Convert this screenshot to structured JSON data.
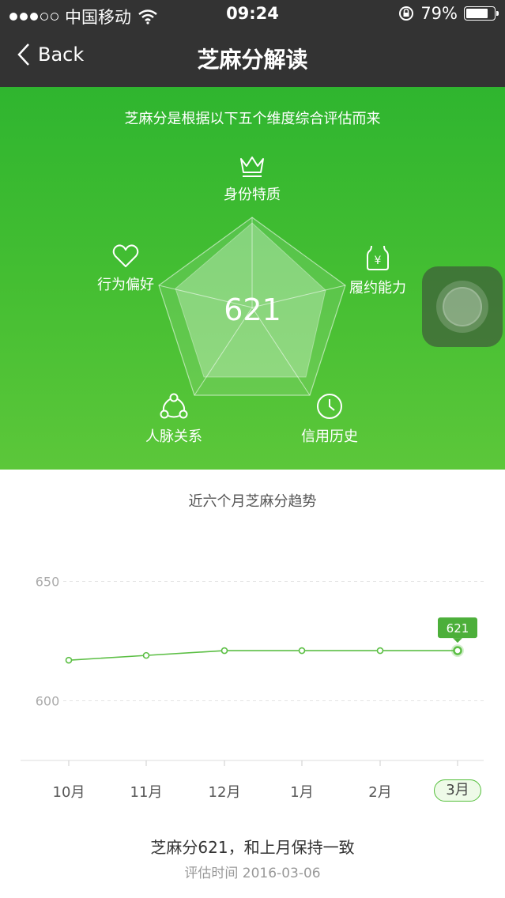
{
  "status_bar": {
    "carrier": "中国移动",
    "time": "09:24",
    "battery": "79%",
    "battery_level": 0.79
  },
  "nav": {
    "back_label": "Back",
    "title": "芝麻分解读"
  },
  "hero": {
    "subtitle": "芝麻分是根据以下五个维度综合评估而来",
    "score": "621",
    "dimensions": [
      {
        "label": "身份特质",
        "icon": "crown-icon"
      },
      {
        "label": "履约能力",
        "icon": "money-bag-icon"
      },
      {
        "label": "信用历史",
        "icon": "clock-icon"
      },
      {
        "label": "人脉关系",
        "icon": "network-icon"
      },
      {
        "label": "行为偏好",
        "icon": "heart-icon"
      }
    ],
    "accent": "#2fb52f"
  },
  "trend": {
    "title": "近六个月芝麻分趋势",
    "summary": "芝麻分621，和上月保持一致",
    "eval_time": "评估时间 2016-03-06"
  },
  "chart_data": {
    "type": "line",
    "categories": [
      "10月",
      "11月",
      "12月",
      "1月",
      "2月",
      "3月"
    ],
    "series": [
      {
        "values": [
          617,
          619,
          621,
          621,
          621,
          621
        ]
      }
    ],
    "ytick_labels": [
      "650",
      "600"
    ],
    "ylim": [
      575,
      675
    ],
    "highlight_label": "621",
    "grid": "dashed horizontal",
    "line_color": "#5cbf45"
  }
}
